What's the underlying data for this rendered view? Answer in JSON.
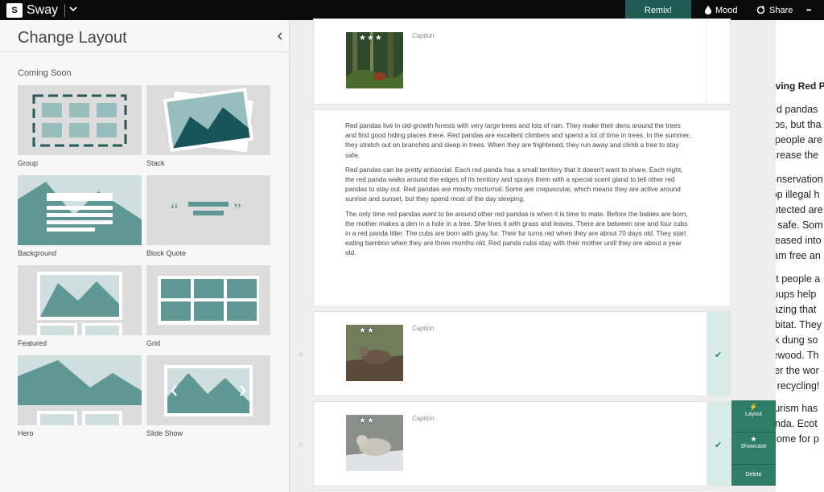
{
  "app": {
    "name": "Sway",
    "logo_text": "S"
  },
  "topbar": {
    "remix": "Remix!",
    "mood": "Mood",
    "share": "Share",
    "more": "•••"
  },
  "panel": {
    "title": "Change Layout",
    "section": "Coming Soon",
    "layouts": [
      "Group",
      "Stack",
      "Background",
      "Block Quote",
      "Featured",
      "Grid",
      "Hero",
      "Slide Show"
    ]
  },
  "cards": [
    {
      "caption": "Caption",
      "stars": "★★★"
    },
    {
      "caption": "Caption",
      "stars": "★★"
    },
    {
      "caption": "Caption",
      "stars": "★★"
    }
  ],
  "text": {
    "p1": "Red pandas live in old-growth forests with very large trees and lots of rain. They make their dens around the trees and find good hiding places there. Red pandas are excellent climbers and spend a lot of time in trees. In the summer, they stretch out on branches and sleep in trees. When they are frightened, they run away and climb a tree to stay safe.",
    "p2": "Red pandas can be pretty antisocial. Each red panda has a small territory that it doesn't want to share. Each night, the red panda walks around the edges of its territory and sprays them with a special scent gland to tell other red pandas to stay out. Red pandas are mostly nocturnal. Some are crepuscular, which means they are active around sunrise and sunset, but they spend most of the day sleeping.",
    "p3": "The only time red pandas want to be around other red pandas is when it is time to mate. Before the babies are born, the mother makes a den in a hole in a tree. She lines it with grass and leaves. There are between one and four cubs in a red panda litter. The cubs are born with gray fur. Their fur turns red when they are about 70 days old. They start eating bamboo when they are three months old. Red panda cubs stay with their mother until they are about a year old."
  },
  "actions": {
    "layout": "Layout",
    "showcase": "Showcase",
    "delete": "Delete"
  },
  "preview": {
    "heading": "Saving Red P",
    "lines1": [
      "Red pandas",
      "zoos, but tha",
      "of people are",
      "increase the"
    ],
    "lines2": [
      "Conservation",
      "stop illegal h",
      "protected are",
      "be safe. Som",
      "released into",
      "roam free an"
    ],
    "lines3": [
      "But people a",
      "groups help",
      "grazing that",
      "habitat. They",
      "yak dung so",
      "firewood. Th",
      "over the wor",
      "as recycling!"
    ],
    "lines4": [
      "Tourism has",
      "panda. Ecot",
      "income for p"
    ]
  },
  "colors": {
    "accent": "#2e7d67",
    "remix": "#1f5c53",
    "tile_fill": "#5e9793",
    "topbar": "#0b0b0b"
  }
}
